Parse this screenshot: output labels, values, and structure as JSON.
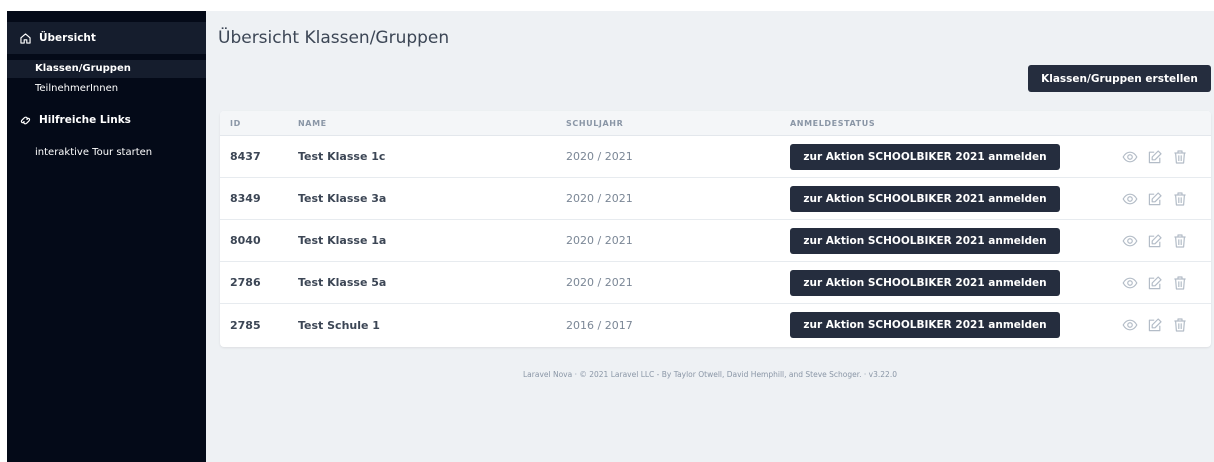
{
  "sidebar": {
    "overview_label": "Übersicht",
    "items": [
      {
        "label": "Klassen/Gruppen"
      },
      {
        "label": "TeilnehmerInnen"
      }
    ],
    "links_section_label": "Hilfreiche Links",
    "tour_label": "interaktive Tour starten"
  },
  "main": {
    "title": "Übersicht Klassen/Gruppen",
    "create_button_label": "Klassen/Gruppen erstellen"
  },
  "table": {
    "columns": [
      "ID",
      "NAME",
      "SCHULJAHR",
      "ANMELDESTATUS"
    ],
    "rows": [
      {
        "id": "8437",
        "name": "Test Klasse 1c",
        "year": "2020 / 2021",
        "status_label": "zur Aktion SCHOOLBIKER 2021 anmelden"
      },
      {
        "id": "8349",
        "name": "Test Klasse 3a",
        "year": "2020 / 2021",
        "status_label": "zur Aktion SCHOOLBIKER 2021 anmelden"
      },
      {
        "id": "8040",
        "name": "Test Klasse 1a",
        "year": "2020 / 2021",
        "status_label": "zur Aktion SCHOOLBIKER 2021 anmelden"
      },
      {
        "id": "2786",
        "name": "Test Klasse 5a",
        "year": "2020 / 2021",
        "status_label": "zur Aktion SCHOOLBIKER 2021 anmelden"
      },
      {
        "id": "2785",
        "name": "Test Schule 1",
        "year": "2016 / 2017",
        "status_label": "zur Aktion SCHOOLBIKER 2021 anmelden"
      }
    ],
    "row_action_icons": [
      "eye-icon",
      "edit-icon",
      "trash-icon"
    ]
  },
  "footer": {
    "text": "Laravel Nova  ·  © 2021 Laravel LLC - By Taylor Otwell, David Hemphill, and Steve Schoger.  ·  v3.22.0"
  },
  "colors": {
    "sidebar_bg": "#040a18",
    "sidebar_active_bg": "#151d2d",
    "content_bg": "#eef1f4",
    "button_bg": "#252d3e",
    "icon_color": "#b3bcc7"
  }
}
